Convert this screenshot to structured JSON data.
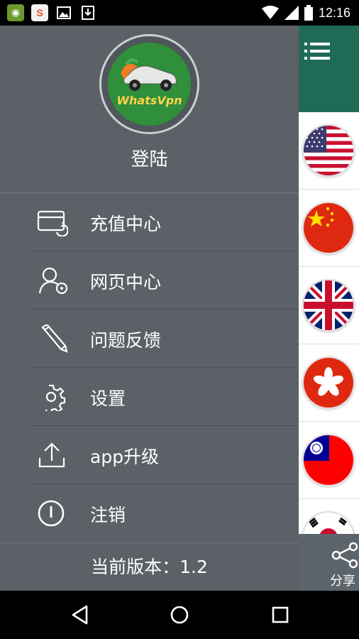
{
  "status_bar": {
    "time": "12:16",
    "left_icons": [
      "gamepad-notification-icon",
      "s-app-notification-icon",
      "image-notification-icon",
      "download-notification-icon"
    ],
    "right_icons": [
      "wifi-icon",
      "cellular-signal-icon",
      "battery-icon"
    ]
  },
  "drawer": {
    "logo_text": "WhatsVpn",
    "login_label": "登陆",
    "menu_items": [
      {
        "label": "充值中心",
        "icon": "recharge-card-icon"
      },
      {
        "label": "网页中心",
        "icon": "user-web-icon"
      },
      {
        "label": "问题反馈",
        "icon": "pencil-icon"
      },
      {
        "label": "设置",
        "icon": "gear-icon"
      },
      {
        "label": "app升级",
        "icon": "upload-icon"
      },
      {
        "label": "注销",
        "icon": "power-icon"
      }
    ],
    "version_text": "当前版本：1.2"
  },
  "main": {
    "share_label": "分享",
    "flags": [
      "flag-usa",
      "flag-china",
      "flag-uk",
      "flag-hong-kong",
      "flag-taiwan",
      "flag-korea"
    ]
  },
  "colors": {
    "drawer_bg": "#5b6167",
    "header_green": "#1f6b56",
    "share_bar": "#5d656c"
  }
}
